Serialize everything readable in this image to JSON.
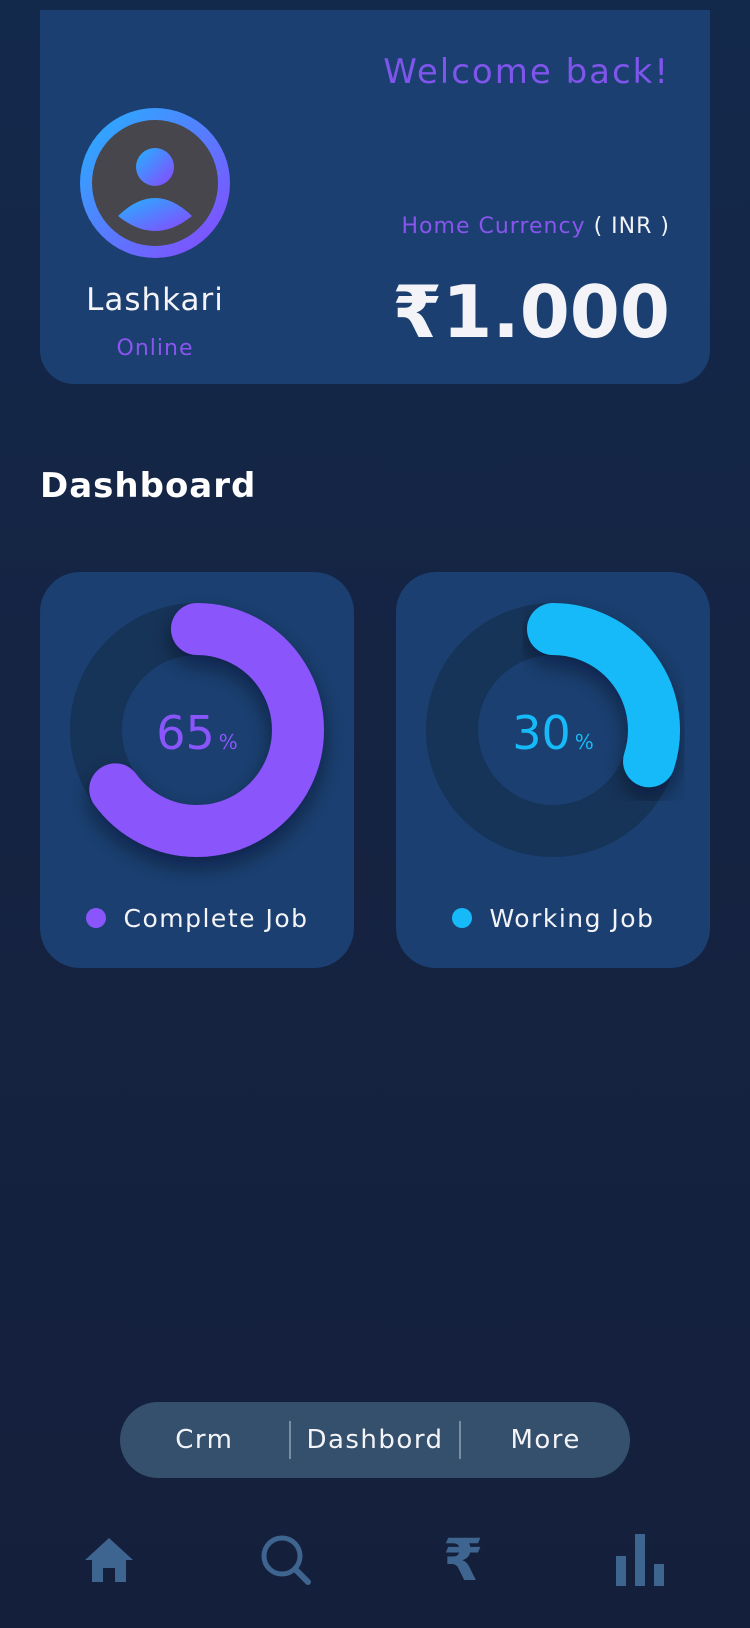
{
  "profile": {
    "name": "Lashkari",
    "status": "Online",
    "welcome": "Welcome back!",
    "currency_label": "Home Currency",
    "currency_code": "( INR )",
    "balance": "₹1.000",
    "avatar_icon": "user-avatar-icon",
    "colors": {
      "accent_purple": "#8a55ee",
      "ring_gradient_start": "#22b4ff",
      "ring_gradient_end": "#8b45ff"
    }
  },
  "dashboard": {
    "title": "Dashboard",
    "stats": [
      {
        "label": "Complete Job",
        "value": "65",
        "unit": "%",
        "fraction": 0.65,
        "color": "#8b55fc"
      },
      {
        "label": "Working Job",
        "value": "30",
        "unit": "%",
        "fraction": 0.3,
        "color": "#17baf9"
      }
    ]
  },
  "pill_menu": {
    "items": [
      "Crm",
      "Dashbord",
      "More"
    ]
  },
  "bottom_nav": {
    "icons": [
      "home-icon",
      "search-icon",
      "rupee-icon",
      "bar-chart-icon"
    ],
    "rupee_glyph": "₹",
    "icon_color": "#3e6590"
  }
}
